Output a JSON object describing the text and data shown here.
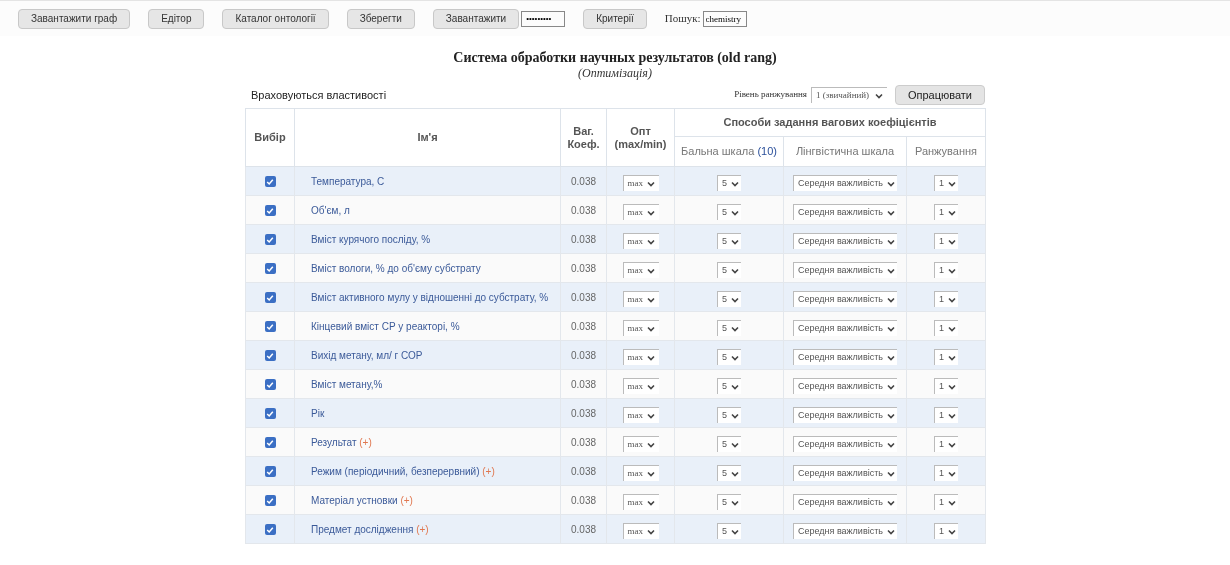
{
  "toolbar": {
    "buttons": [
      "Завантажити граф",
      "Едітор",
      "Каталог онтології",
      "Зберегти"
    ],
    "load_button": "Завантажити",
    "password": {
      "value": "•••••••••"
    },
    "criteria_button": "Критерії",
    "search": {
      "label": "Пошук:",
      "value": "chemistry"
    }
  },
  "title": "Система обработки научных результатов (old rang)",
  "subtitle": "(Оптимізація)",
  "section_label": "Враховуються властивості",
  "ranking_level": {
    "label": "Рівень ранжування",
    "value": "1 (звичайний)"
  },
  "process_button": "Опрацювати",
  "table": {
    "columns": {
      "select": "Вибір",
      "name": "Ім'я",
      "weight": "Ваг. Коеф.",
      "opt": "Опт (max/min)",
      "group": "Способи задання вагових коефіцієнтів",
      "score": "Бальна шкала",
      "score_count": "(10)",
      "linguistic": "Лінгвістична шкала",
      "rank": "Ранжування"
    },
    "rows": [
      {
        "checked": true,
        "name": "Температура, С",
        "weight": "0.038",
        "opt": "max",
        "score": "5",
        "linguistic": "Середня важливість",
        "rank": "1"
      },
      {
        "checked": true,
        "name": "Об'єм, л",
        "weight": "0.038",
        "opt": "max",
        "score": "5",
        "linguistic": "Середня важливість",
        "rank": "1"
      },
      {
        "checked": true,
        "name": "Вміст курячого посліду, %",
        "weight": "0.038",
        "opt": "max",
        "score": "5",
        "linguistic": "Середня важливість",
        "rank": "1"
      },
      {
        "checked": true,
        "name": "Вміст вологи, % до об'єму субстрату",
        "weight": "0.038",
        "opt": "max",
        "score": "5",
        "linguistic": "Середня важливість",
        "rank": "1"
      },
      {
        "checked": true,
        "name": "Вміст активного мулу у відношенні до субстрату, %",
        "weight": "0.038",
        "opt": "max",
        "score": "5",
        "linguistic": "Середня важливість",
        "rank": "1"
      },
      {
        "checked": true,
        "name": "Кінцевий вміст СР у реакторі, %",
        "weight": "0.038",
        "opt": "max",
        "score": "5",
        "linguistic": "Середня важливість",
        "rank": "1"
      },
      {
        "checked": true,
        "name": "Вихід метану, мл/ г СОР",
        "weight": "0.038",
        "opt": "max",
        "score": "5",
        "linguistic": "Середня важливість",
        "rank": "1"
      },
      {
        "checked": true,
        "name": "Вміст метану,%",
        "weight": "0.038",
        "opt": "max",
        "score": "5",
        "linguistic": "Середня важливість",
        "rank": "1"
      },
      {
        "checked": true,
        "name": "Рік",
        "weight": "0.038",
        "opt": "max",
        "score": "5",
        "linguistic": "Середня важливість",
        "rank": "1"
      },
      {
        "checked": true,
        "name": "Результат",
        "suffix": "(+)",
        "weight": "0.038",
        "opt": "max",
        "score": "5",
        "linguistic": "Середня важливість",
        "rank": "1"
      },
      {
        "checked": true,
        "name": "Режим (періодичний, безперервний)",
        "suffix": "(+)",
        "weight": "0.038",
        "opt": "max",
        "score": "5",
        "linguistic": "Середня важливість",
        "rank": "1"
      },
      {
        "checked": true,
        "name": "Матеріал устновки",
        "suffix": "(+)",
        "weight": "0.038",
        "opt": "max",
        "score": "5",
        "linguistic": "Середня важливість",
        "rank": "1"
      },
      {
        "checked": true,
        "name": "Предмет дослідження",
        "suffix": "(+)",
        "weight": "0.038",
        "opt": "max",
        "score": "5",
        "linguistic": "Середня важливість",
        "rank": "1"
      }
    ]
  }
}
